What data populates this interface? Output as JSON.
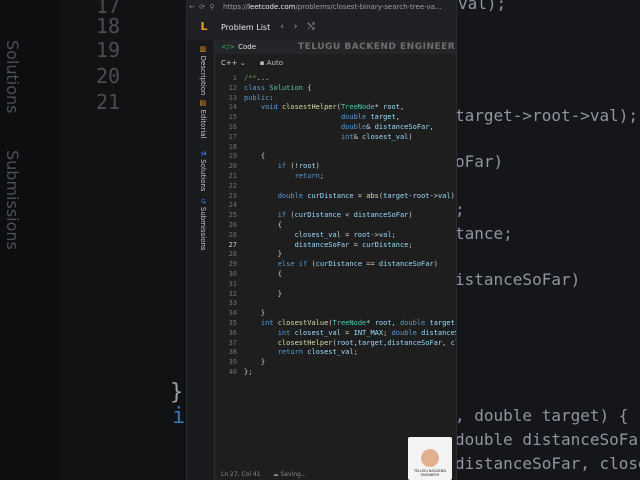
{
  "background": {
    "line_numbers": [
      "17",
      "18",
      "19",
      "20",
      "21"
    ],
    "vertical_tabs": [
      "Solutions",
      "Submissions"
    ],
    "right_fragments": [
      "val);",
      "target->root->val);",
      "oFar)",
      ";",
      "tance;",
      "istanceSoFar)",
      ", double target) {",
      "double distanceSoFar",
      "distanceSoFar, closest"
    ],
    "left_brace": "}",
    "left_if": "i"
  },
  "browser": {
    "url_prefix": "https://",
    "url_domain": "leetcode.com",
    "url_path": "/problems/closest-binary-search-tree-va..."
  },
  "topbar": {
    "logo": "L",
    "problem_list": "Problem List",
    "prev": "‹",
    "next": "›",
    "shuffle": "⤭"
  },
  "side_tabs": {
    "description": "Description",
    "editorial": "Editorial",
    "solutions": "Solutions",
    "submissions": "Submissions"
  },
  "editor": {
    "tab_label": "Code",
    "watermark": "TELUGU BACKEND ENGINEER",
    "language": "C++",
    "mode": "Auto",
    "lines": [
      {
        "n": "1",
        "html": "<span class='cm'>/**</span>..."
      },
      {
        "n": "12",
        "html": "<span class='kw'>class</span> <span class='ty'>Solution</span> {"
      },
      {
        "n": "13",
        "html": "<span class='kw'>public</span>:"
      },
      {
        "n": "14",
        "html": "    <span class='kw'>void</span> <span class='fn'>closestHelper</span>(<span class='ty'>TreeNode</span>* <span class='var'>root</span>,"
      },
      {
        "n": "15",
        "html": "                       <span class='kw'>double</span> <span class='var'>target</span>,"
      },
      {
        "n": "16",
        "html": "                       <span class='kw'>double</span>&amp; <span class='var'>distanceSoFar</span>,"
      },
      {
        "n": "17",
        "html": "                       <span class='kw'>int</span>&amp; <span class='var'>closest_val</span>)"
      },
      {
        "n": "18",
        "html": ""
      },
      {
        "n": "19",
        "html": "    {"
      },
      {
        "n": "20",
        "html": "        <span class='kw'>if</span> (!<span class='var'>root</span>)"
      },
      {
        "n": "21",
        "html": "            <span class='kw'>return</span>;"
      },
      {
        "n": "22",
        "html": ""
      },
      {
        "n": "23",
        "html": "        <span class='kw'>double</span> <span class='var'>curDistance</span> = <span class='fn'>abs</span>(<span class='var'>target</span>-<span class='var'>root</span>-&gt;<span class='var'>val</span>);"
      },
      {
        "n": "24",
        "html": ""
      },
      {
        "n": "25",
        "html": "        <span class='kw'>if</span> (<span class='var'>curDistance</span> &lt; <span class='var'>distanceSoFar</span>)"
      },
      {
        "n": "26",
        "html": "        {"
      },
      {
        "n": "26b",
        "html": "            <span class='var'>closest_val</span> = <span class='var'>root</span>-&gt;<span class='var'>val</span>;"
      },
      {
        "n": "27",
        "html": "            <span class='var'>distanceSoFar</span> = <span class='var'>curDistance</span>;"
      },
      {
        "n": "28",
        "html": "        }"
      },
      {
        "n": "29",
        "html": "        <span class='kw'>else if</span> (<span class='var'>curDistance</span> == <span class='var'>distanceSoFar</span>)"
      },
      {
        "n": "30",
        "html": "        {"
      },
      {
        "n": "31",
        "html": ""
      },
      {
        "n": "32",
        "html": "        }"
      },
      {
        "n": "33",
        "html": ""
      },
      {
        "n": "34",
        "html": "    }"
      },
      {
        "n": "35",
        "html": "    <span class='kw'>int</span> <span class='fn'>closestValue</span>(<span class='ty'>TreeNode</span>* <span class='var'>root</span>, <span class='kw'>double</span> <span class='var'>target</span>) {"
      },
      {
        "n": "36",
        "html": "        <span class='kw'>int</span> <span class='var'>closest_val</span> = <span class='var'>INT_MAX</span>; <span class='kw'>double</span> <span class='var'>distanceSoFar</span>"
      },
      {
        "n": "37",
        "html": "        <span class='fn'>closestHelper</span>(<span class='var'>root</span>,<span class='var'>target</span>,<span class='var'>distanceSoFar</span>, <span class='var'>closest</span>"
      },
      {
        "n": "38",
        "html": "        <span class='kw'>return</span> <span class='var'>closest_val</span>;"
      },
      {
        "n": "39",
        "html": "    }"
      },
      {
        "n": "40",
        "html": "};"
      }
    ]
  },
  "status": {
    "position": "Ln 27, Col 41",
    "saving": "Saving..."
  },
  "badge": {
    "line1": "TELUGU BACKEND",
    "line2": "ENGINEER"
  }
}
